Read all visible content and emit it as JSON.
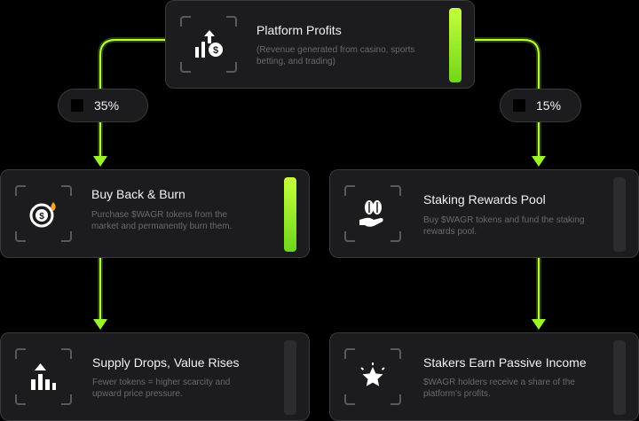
{
  "colors": {
    "accent": "#9cf52a",
    "card": "#1c1c1e",
    "border": "#3a3a3c",
    "text": "#f2f2f2",
    "muted": "#6a6a6c"
  },
  "nodes": {
    "platform": {
      "title": "Platform Profits",
      "desc": "(Revenue generated from casino, sports betting, and trading)",
      "icon": "growth-dollar-icon",
      "highlighted": true
    },
    "burn": {
      "title": "Buy Back & Burn",
      "desc": "Purchase $WAGR tokens from the market and permanently burn them.",
      "icon": "coin-flame-icon",
      "highlighted": true
    },
    "staking_pool": {
      "title": "Staking Rewards Pool",
      "desc": "Buy $WAGR tokens and fund the staking rewards pool.",
      "icon": "hand-coins-icon",
      "highlighted": false
    },
    "supply": {
      "title": "Supply Drops, Value Rises",
      "desc": "Fewer tokens = higher scarcity and upward price pressure.",
      "icon": "bar-chart-up-icon",
      "highlighted": false
    },
    "passive": {
      "title": "Stakers Earn Passive Income",
      "desc": "$WAGR holders receive a share of the platform's profits.",
      "icon": "star-badge-icon",
      "highlighted": false
    }
  },
  "splits": {
    "left": "35%",
    "right": "15%"
  }
}
